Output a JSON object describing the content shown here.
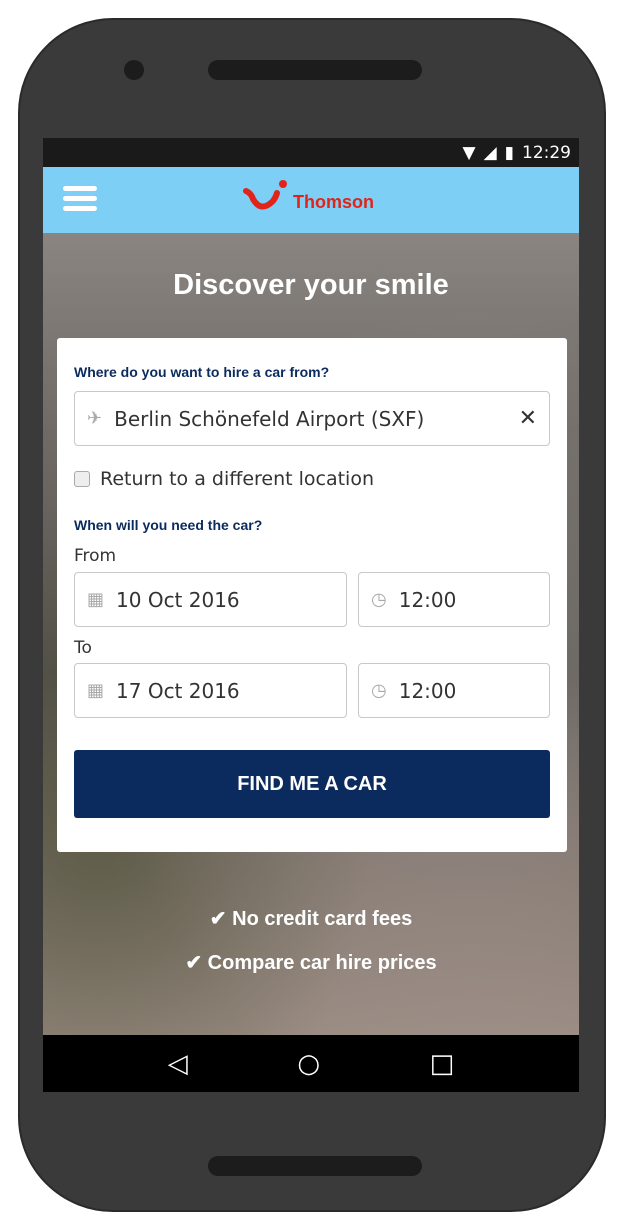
{
  "status": {
    "time": "12:29"
  },
  "header": {
    "brand": "Thomson",
    "brand_color": "#e2231a",
    "bar_color": "#7dcff5"
  },
  "hero": {
    "title": "Discover your smile"
  },
  "form": {
    "location_label": "Where do you want to hire a car from?",
    "location_value": "Berlin Schönefeld Airport (SXF)",
    "return_label": "Return to a different location",
    "return_checked": false,
    "when_label": "When will you need the car?",
    "from_label": "From",
    "from_date": "10 Oct 2016",
    "from_time": "12:00",
    "to_label": "To",
    "to_date": "17 Oct 2016",
    "to_time": "12:00",
    "submit": "FIND ME A CAR",
    "submit_color": "#0b2a5e"
  },
  "perks": [
    "No credit card fees",
    "Compare car hire prices"
  ]
}
